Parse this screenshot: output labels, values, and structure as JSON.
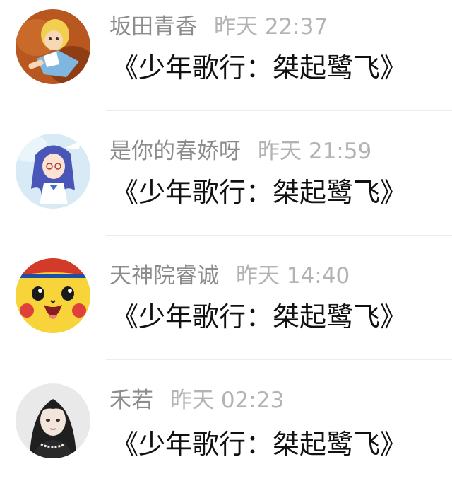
{
  "comments": [
    {
      "username": "坂田青香",
      "time": "昨天 22:37",
      "text": "《少年歌行：桀起鹭飞》",
      "avatar_icon": "cartoon-girl-avatar-icon"
    },
    {
      "username": "是你的春娇呀",
      "time": "昨天 21:59",
      "text": "《少年歌行：桀起鹭飞》",
      "avatar_icon": "anime-girl-avatar-icon"
    },
    {
      "username": "天神院睿诚",
      "time": "昨天 14:40",
      "text": "《少年歌行：桀起鹭飞》",
      "avatar_icon": "pikachu-avatar-icon"
    },
    {
      "username": "禾若",
      "time": "昨天 02:23",
      "text": "《少年歌行：桀起鹭飞》",
      "avatar_icon": "portrait-avatar-icon"
    }
  ],
  "colors": {
    "username": "#8c8c8c",
    "timestamp": "#b3b3b3",
    "message": "#111111",
    "divider": "#ececec"
  }
}
